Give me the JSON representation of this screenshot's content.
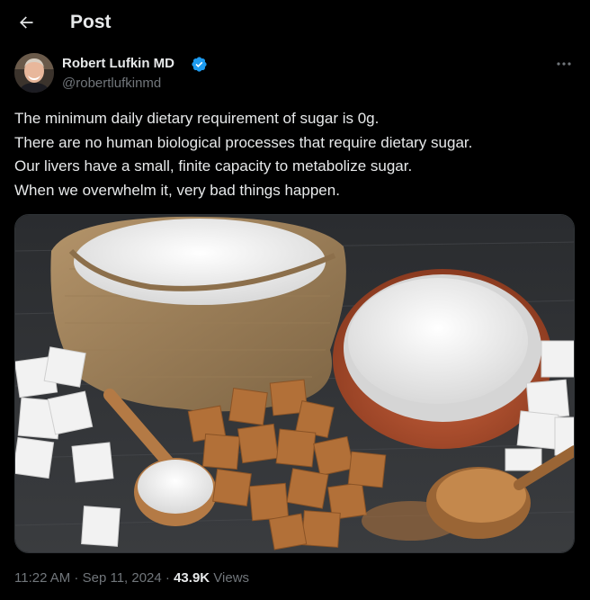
{
  "header": {
    "back_icon": "arrow-left-icon",
    "title": "Post"
  },
  "author": {
    "display_name": "Robert Lufkin MD",
    "handle": "@robertlufkinmd",
    "verified_icon": "verified-badge-icon",
    "verified_color": "#1d9bf0"
  },
  "more_icon": "more-horizontal-icon",
  "tweet": {
    "lines": [
      "The minimum daily dietary requirement of sugar is 0g.",
      "There are no human biological processes that require dietary sugar.",
      "Our livers have a small, finite capacity to metabolize sugar.",
      "When we overwhelm it, very bad things happen."
    ]
  },
  "meta": {
    "time": "11:22 AM",
    "separator": " · ",
    "date": "Sep 11, 2024",
    "views_count": "43.9K",
    "views_label": "Views"
  }
}
